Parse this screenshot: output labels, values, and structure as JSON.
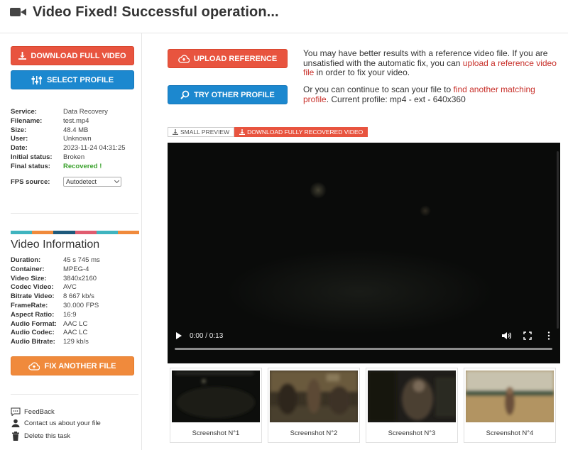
{
  "header": {
    "title": "Video Fixed! Successful operation...",
    "icon": "video-camera-icon"
  },
  "left": {
    "download_full_video": "DOWNLOAD FULL VIDEO",
    "select_profile": "SELECT PROFILE",
    "service_info": [
      {
        "key": "Service:",
        "value": "Data Recovery"
      },
      {
        "key": "Filename:",
        "value": "test.mp4"
      },
      {
        "key": "Size:",
        "value": "48.4 MB"
      },
      {
        "key": "User:",
        "value": "Unknown"
      },
      {
        "key": "Date:",
        "value": "2023-11-24 04:31:25"
      },
      {
        "key": "Initial status:",
        "value": "Broken"
      },
      {
        "key": "Final status:",
        "value": "Recovered !"
      }
    ],
    "fps": {
      "label": "FPS source:",
      "selected": "Autodetect"
    },
    "colorbar": [
      "#3fb4bf",
      "#f08a3c",
      "#1e5a7c",
      "#e05c6f",
      "#3fb4bf",
      "#f08a3c"
    ],
    "video_info_title": "Video Information",
    "video_info": [
      {
        "key": "Duration:",
        "value": "45 s 745 ms"
      },
      {
        "key": "Container:",
        "value": "MPEG-4"
      },
      {
        "key": "Video Size:",
        "value": "3840x2160"
      },
      {
        "key": "Codec Video:",
        "value": "AVC"
      },
      {
        "key": "Bitrate Video:",
        "value": "8 667 kb/s"
      },
      {
        "key": "FrameRate:",
        "value": "30.000 FPS"
      },
      {
        "key": "Aspect Ratio:",
        "value": "16:9"
      },
      {
        "key": "Audio Format:",
        "value": "AAC LC"
      },
      {
        "key": "Audio Codec:",
        "value": "AAC LC"
      },
      {
        "key": "Audio Bitrate:",
        "value": "129 kb/s"
      }
    ],
    "fix_another": "FIX ANOTHER FILE",
    "links": {
      "feedback": "FeedBack",
      "contact": "Contact us about your file",
      "delete": "Delete this task"
    }
  },
  "main": {
    "upload_reference": "UPLOAD REFERENCE",
    "try_other_profile": "TRY OTHER PROFILE",
    "para1_a": "You may have better results with a reference video file. If you are unsatisfied with the automatic fix, you can ",
    "para1_link": "upload a reference video file",
    "para1_b": " in order to fix your video.",
    "para2_a": "Or you can continue to scan your file to ",
    "para2_link": "find another matching profile",
    "para2_b": ". Current profile: mp4 - ext - 640x360",
    "tab_small_preview": "SMALL PREVIEW",
    "tab_download_recovered": "DOWNLOAD FULLY RECOVERED VIDEO",
    "player": {
      "time": "0:00 / 0:13"
    },
    "screenshots": [
      "Screenshot N°1",
      "Screenshot N°2",
      "Screenshot N°3",
      "Screenshot N°4"
    ]
  }
}
